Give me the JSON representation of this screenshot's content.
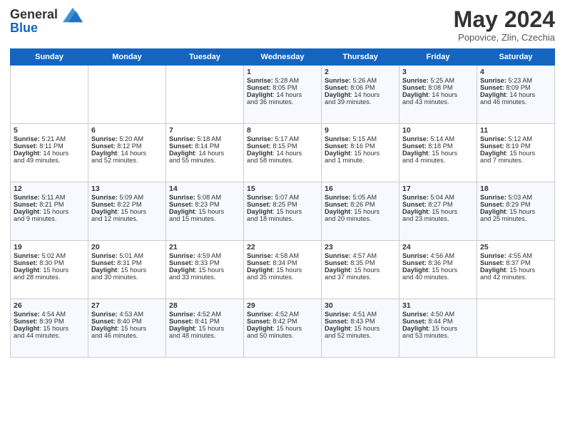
{
  "header": {
    "logo_line1": "General",
    "logo_line2": "Blue",
    "month_year": "May 2024",
    "location": "Popovice, Zlin, Czechia"
  },
  "days_of_week": [
    "Sunday",
    "Monday",
    "Tuesday",
    "Wednesday",
    "Thursday",
    "Friday",
    "Saturday"
  ],
  "weeks": [
    [
      {
        "day": "",
        "info": ""
      },
      {
        "day": "",
        "info": ""
      },
      {
        "day": "",
        "info": ""
      },
      {
        "day": "1",
        "info": "Sunrise: 5:28 AM\nSunset: 8:05 PM\nDaylight: 14 hours\nand 36 minutes."
      },
      {
        "day": "2",
        "info": "Sunrise: 5:26 AM\nSunset: 8:06 PM\nDaylight: 14 hours\nand 39 minutes."
      },
      {
        "day": "3",
        "info": "Sunrise: 5:25 AM\nSunset: 8:08 PM\nDaylight: 14 hours\nand 43 minutes."
      },
      {
        "day": "4",
        "info": "Sunrise: 5:23 AM\nSunset: 8:09 PM\nDaylight: 14 hours\nand 46 minutes."
      }
    ],
    [
      {
        "day": "5",
        "info": "Sunrise: 5:21 AM\nSunset: 8:11 PM\nDaylight: 14 hours\nand 49 minutes."
      },
      {
        "day": "6",
        "info": "Sunrise: 5:20 AM\nSunset: 8:12 PM\nDaylight: 14 hours\nand 52 minutes."
      },
      {
        "day": "7",
        "info": "Sunrise: 5:18 AM\nSunset: 8:14 PM\nDaylight: 14 hours\nand 55 minutes."
      },
      {
        "day": "8",
        "info": "Sunrise: 5:17 AM\nSunset: 8:15 PM\nDaylight: 14 hours\nand 58 minutes."
      },
      {
        "day": "9",
        "info": "Sunrise: 5:15 AM\nSunset: 8:16 PM\nDaylight: 15 hours\nand 1 minute."
      },
      {
        "day": "10",
        "info": "Sunrise: 5:14 AM\nSunset: 8:18 PM\nDaylight: 15 hours\nand 4 minutes."
      },
      {
        "day": "11",
        "info": "Sunrise: 5:12 AM\nSunset: 8:19 PM\nDaylight: 15 hours\nand 7 minutes."
      }
    ],
    [
      {
        "day": "12",
        "info": "Sunrise: 5:11 AM\nSunset: 8:21 PM\nDaylight: 15 hours\nand 9 minutes."
      },
      {
        "day": "13",
        "info": "Sunrise: 5:09 AM\nSunset: 8:22 PM\nDaylight: 15 hours\nand 12 minutes."
      },
      {
        "day": "14",
        "info": "Sunrise: 5:08 AM\nSunset: 8:23 PM\nDaylight: 15 hours\nand 15 minutes."
      },
      {
        "day": "15",
        "info": "Sunrise: 5:07 AM\nSunset: 8:25 PM\nDaylight: 15 hours\nand 18 minutes."
      },
      {
        "day": "16",
        "info": "Sunrise: 5:05 AM\nSunset: 8:26 PM\nDaylight: 15 hours\nand 20 minutes."
      },
      {
        "day": "17",
        "info": "Sunrise: 5:04 AM\nSunset: 8:27 PM\nDaylight: 15 hours\nand 23 minutes."
      },
      {
        "day": "18",
        "info": "Sunrise: 5:03 AM\nSunset: 8:29 PM\nDaylight: 15 hours\nand 25 minutes."
      }
    ],
    [
      {
        "day": "19",
        "info": "Sunrise: 5:02 AM\nSunset: 8:30 PM\nDaylight: 15 hours\nand 28 minutes."
      },
      {
        "day": "20",
        "info": "Sunrise: 5:01 AM\nSunset: 8:31 PM\nDaylight: 15 hours\nand 30 minutes."
      },
      {
        "day": "21",
        "info": "Sunrise: 4:59 AM\nSunset: 8:33 PM\nDaylight: 15 hours\nand 33 minutes."
      },
      {
        "day": "22",
        "info": "Sunrise: 4:58 AM\nSunset: 8:34 PM\nDaylight: 15 hours\nand 35 minutes."
      },
      {
        "day": "23",
        "info": "Sunrise: 4:57 AM\nSunset: 8:35 PM\nDaylight: 15 hours\nand 37 minutes."
      },
      {
        "day": "24",
        "info": "Sunrise: 4:56 AM\nSunset: 8:36 PM\nDaylight: 15 hours\nand 40 minutes."
      },
      {
        "day": "25",
        "info": "Sunrise: 4:55 AM\nSunset: 8:37 PM\nDaylight: 15 hours\nand 42 minutes."
      }
    ],
    [
      {
        "day": "26",
        "info": "Sunrise: 4:54 AM\nSunset: 8:39 PM\nDaylight: 15 hours\nand 44 minutes."
      },
      {
        "day": "27",
        "info": "Sunrise: 4:53 AM\nSunset: 8:40 PM\nDaylight: 15 hours\nand 46 minutes."
      },
      {
        "day": "28",
        "info": "Sunrise: 4:52 AM\nSunset: 8:41 PM\nDaylight: 15 hours\nand 48 minutes."
      },
      {
        "day": "29",
        "info": "Sunrise: 4:52 AM\nSunset: 8:42 PM\nDaylight: 15 hours\nand 50 minutes."
      },
      {
        "day": "30",
        "info": "Sunrise: 4:51 AM\nSunset: 8:43 PM\nDaylight: 15 hours\nand 52 minutes."
      },
      {
        "day": "31",
        "info": "Sunrise: 4:50 AM\nSunset: 8:44 PM\nDaylight: 15 hours\nand 53 minutes."
      },
      {
        "day": "",
        "info": ""
      }
    ]
  ]
}
